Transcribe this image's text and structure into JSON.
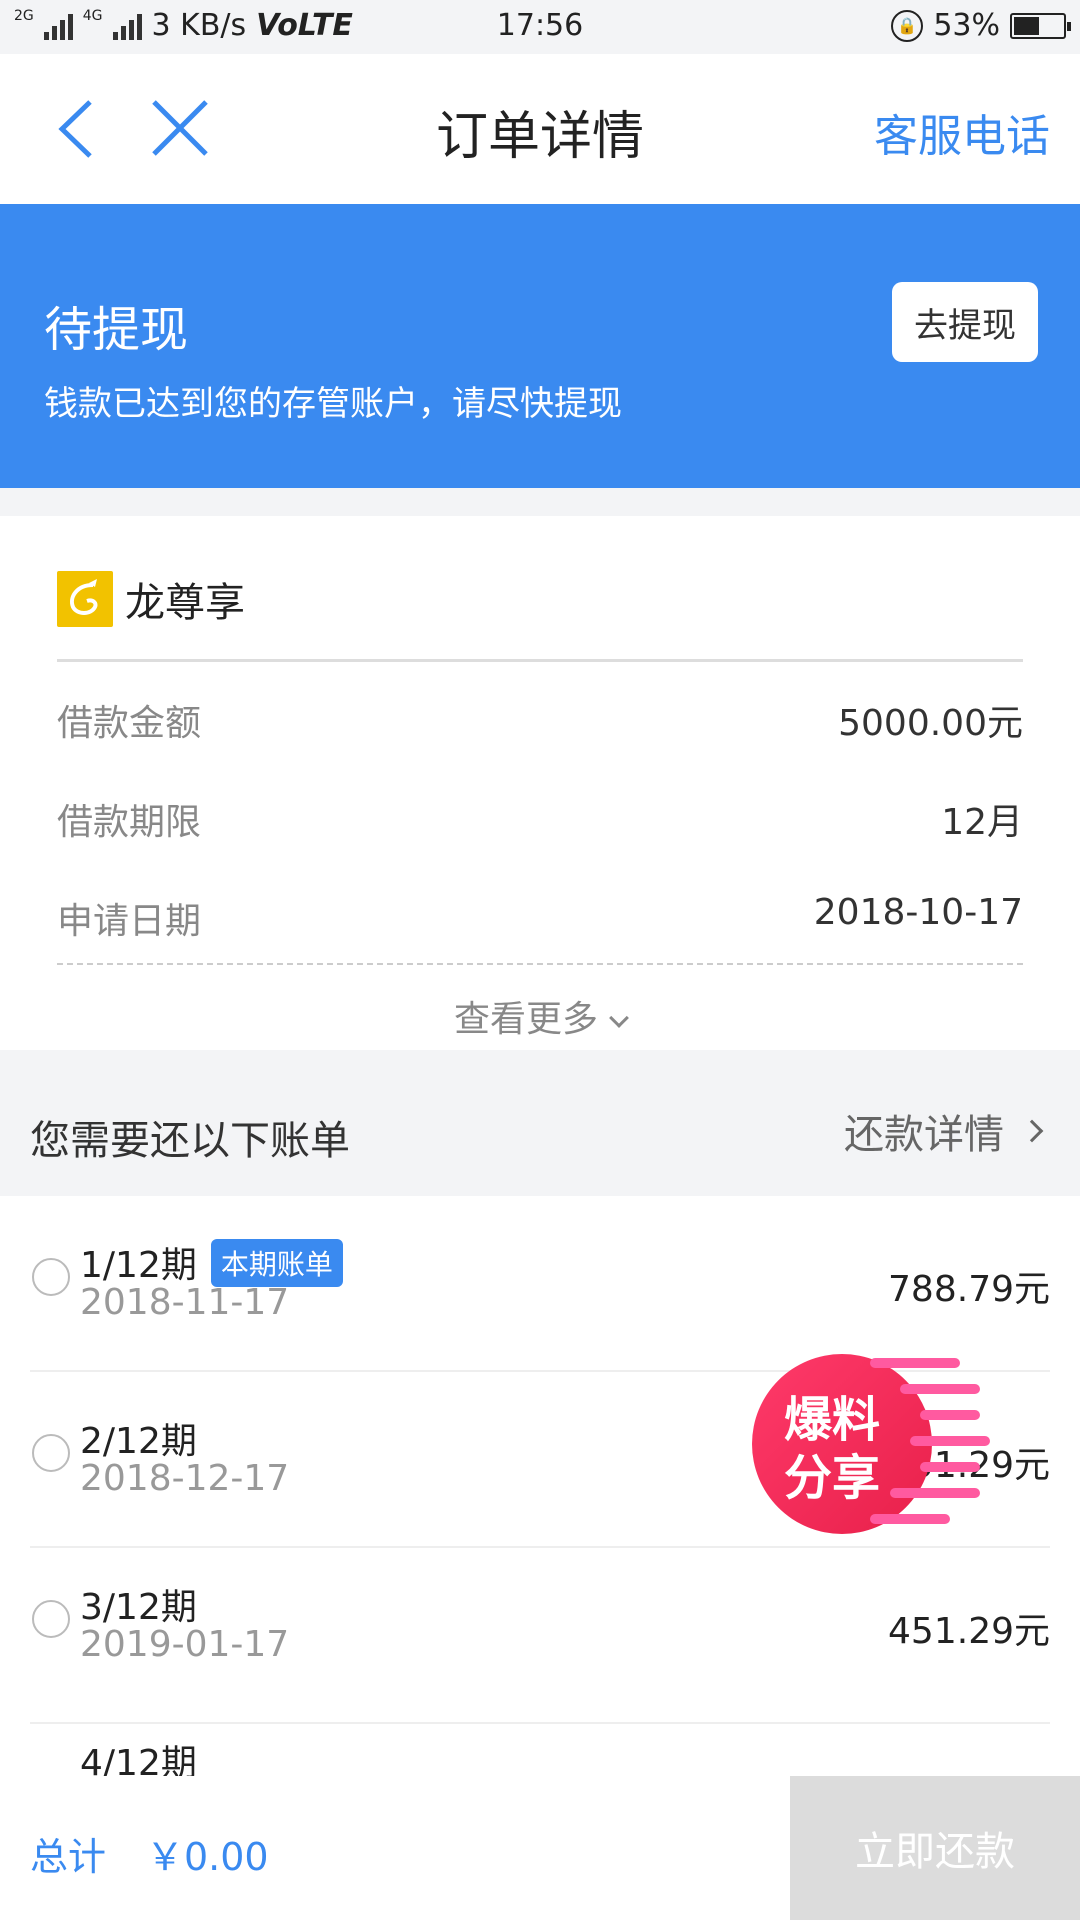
{
  "status_bar": {
    "net_labels": [
      "2G",
      "4G"
    ],
    "speed": "3 KB/s",
    "volte": "VoLTE",
    "time": "17:56",
    "battery_text": "53%",
    "battery_level": 0.53
  },
  "nav": {
    "title": "订单详情",
    "service_label": "客服电话",
    "back_icon": "chevron-left-icon",
    "close_icon": "close-icon"
  },
  "banner": {
    "status_title": "待提现",
    "status_desc": "钱款已达到您的存管账户，请尽快提现",
    "withdraw_label": "去提现",
    "color": "#3a8af0"
  },
  "order": {
    "product_name": "龙尊享",
    "fields": [
      {
        "label": "借款金额",
        "value": "5000.00元"
      },
      {
        "label": "借款期限",
        "value": "12月"
      },
      {
        "label": "申请日期",
        "value": "2018-10-17"
      }
    ],
    "more_label": "查看更多"
  },
  "bills_header": {
    "title": "您需要还以下账单",
    "detail_label": "还款详情"
  },
  "bills": [
    {
      "period": "1/12期",
      "tag": "本期账单",
      "date": "2018-11-17",
      "amount": "788.79元"
    },
    {
      "period": "2/12期",
      "tag": "",
      "date": "2018-12-17",
      "amount": "451.29元"
    },
    {
      "period": "3/12期",
      "tag": "",
      "date": "2019-01-17",
      "amount": "451.29元"
    },
    {
      "period": "4/12期",
      "tag": "",
      "date": "",
      "amount": ""
    }
  ],
  "watermark": {
    "line1": "爆料",
    "line2": "分享"
  },
  "bottom": {
    "total_label": "总计",
    "total_value": "￥0.00",
    "pay_label": "立即还款"
  }
}
